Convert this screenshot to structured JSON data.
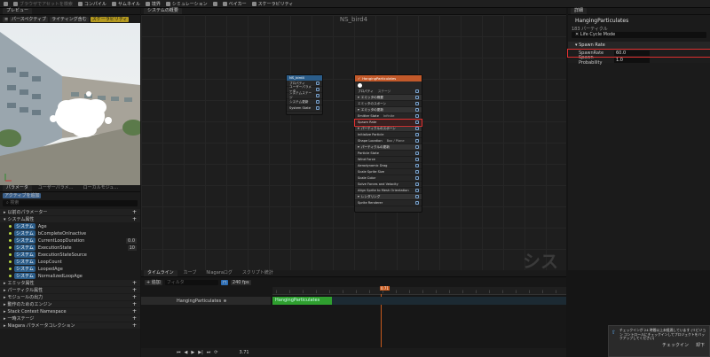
{
  "toolbar": {
    "items": [
      {
        "label": "",
        "icon": "save-icon",
        "dim": false
      },
      {
        "label": "ブラウザでアセットを検索",
        "icon": "browse-icon",
        "dim": true
      },
      {
        "label": "コンパイル",
        "icon": "compile-icon",
        "dim": false
      },
      {
        "label": "サムネイル",
        "icon": "thumbnail-icon",
        "dim": false
      },
      {
        "label": "境界",
        "icon": "bounds-icon",
        "dim": false
      },
      {
        "label": "シミュレーション",
        "icon": "simulation-icon",
        "dim": false
      },
      {
        "label": "",
        "icon": "record-icon",
        "dim": false
      },
      {
        "label": "ベイカー",
        "icon": "baker-icon",
        "dim": false
      },
      {
        "label": "スケーラビリティ",
        "icon": "scalability-icon",
        "dim": false
      }
    ]
  },
  "preview": {
    "tab": "プレビュー",
    "perspective": "パースペクティブ",
    "lighting": "ライティング含む",
    "scalability": "スケーラビリティ"
  },
  "params": {
    "tabs": [
      "パラメータ",
      "ユーザーパラメ…",
      "ローカルモジュ…"
    ],
    "add_button": "アクティブを追加",
    "search_placeholder": "検索",
    "sections": [
      {
        "label": "以前のパラメーター"
      },
      {
        "label": "システム属性"
      }
    ],
    "system_attrs": [
      {
        "tag": "システム",
        "name": "Age",
        "value": ""
      },
      {
        "tag": "システム",
        "name": "bCompleteOnInactive",
        "value": ""
      },
      {
        "tag": "システム",
        "name": "CurrentLoopDuration",
        "value": "0.0"
      },
      {
        "tag": "システム",
        "name": "ExecutionState",
        "value": "10"
      },
      {
        "tag": "システム",
        "name": "ExecutionStateSource",
        "value": ""
      },
      {
        "tag": "システム",
        "name": "LoopCount",
        "value": ""
      },
      {
        "tag": "システム",
        "name": "LoopedAge",
        "value": ""
      },
      {
        "tag": "システム",
        "name": "NormalizedLoopAge",
        "value": ""
      }
    ],
    "more_sections": [
      "エミッタ属性",
      "パーティクル属性",
      "モジュールの出力",
      "動作のためのエンジン",
      "Stack Context Namespace",
      "一時ステージ",
      "Niagara パラメータコレクション"
    ]
  },
  "graph": {
    "tab": "システムの概要",
    "title": "NS_bird4",
    "watermark": "システム",
    "system_node": {
      "title": "NS_bird4",
      "rows": [
        "プロパティ",
        "ユーザーパラメータ",
        "システムステージ",
        "システム更新",
        "System State"
      ]
    },
    "emitter_node": {
      "title": "HangingParticulates",
      "rows": [
        {
          "label": "プロパティ",
          "type": "row",
          "extra": "ステージ"
        },
        {
          "label": "エミッタの概要",
          "type": "sec"
        },
        {
          "label": "エミッタのスポーン",
          "type": "row"
        },
        {
          "label": "エミッタの更新",
          "type": "sec"
        },
        {
          "label": "Emitter State",
          "type": "row",
          "extra": "Infinite"
        },
        {
          "label": "Spawn Rate",
          "type": "row",
          "hl": true
        },
        {
          "label": "パーティクルのスポーン",
          "type": "sec"
        },
        {
          "label": "Initialize Particle",
          "type": "row"
        },
        {
          "label": "Shape Location",
          "type": "row",
          "extra": "Box / Plane"
        },
        {
          "label": "パーティクルの更新",
          "type": "sec"
        },
        {
          "label": "Particle State",
          "type": "row"
        },
        {
          "label": "Wind Force",
          "type": "row"
        },
        {
          "label": "Aerodynamic Drag",
          "type": "row"
        },
        {
          "label": "Scale Sprite Size",
          "type": "row"
        },
        {
          "label": "Scale Color",
          "type": "row"
        },
        {
          "label": "Solve Forces and Velocity",
          "type": "row"
        },
        {
          "label": "Align Sprite to Mesh Orientation",
          "type": "row"
        },
        {
          "label": "レンダリング",
          "type": "sec"
        },
        {
          "label": "Sprite Renderer",
          "type": "row"
        }
      ]
    }
  },
  "details": {
    "tab": "詳細",
    "title": "HangingParticulates",
    "subtitle": "183 パーティクル",
    "filter": "Life Cycle Mode",
    "section": "Spawn Rate",
    "props": [
      {
        "label": "SpawnRate",
        "value": "60.0"
      },
      {
        "label": "Spawn Probability",
        "value": "1.0"
      }
    ]
  },
  "timeline": {
    "tabs": [
      "タイムライン",
      "カーブ",
      "Niagaraログ",
      "スクリプト統計"
    ],
    "add_label": "+ 追加",
    "filter_placeholder": "フィルタ",
    "fps": "240 fps",
    "time": "0.71",
    "track": "HangingParticulates",
    "clip": "HangingParticulates",
    "bottom_labels": [
      "-0.10",
      "-0.10",
      "0.71",
      "0.71",
      "11.10",
      "11.40"
    ],
    "play_time": "3.71"
  },
  "notification": {
    "text": "チェックインが 24 時間以上未経過しています (リビジョン コントロールにチェックインしてプロジェクトをバックアップしてください)",
    "btn1": "チェックイン",
    "btn2": "却下"
  }
}
